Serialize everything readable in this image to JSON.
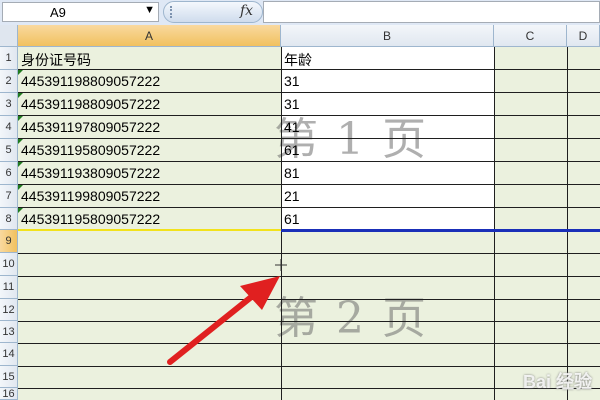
{
  "formula_bar": {
    "name_box": "A9",
    "fx_label": "fx",
    "formula": ""
  },
  "columns": [
    {
      "label": "A",
      "selected": true
    },
    {
      "label": "B",
      "selected": false
    },
    {
      "label": "C",
      "selected": false
    },
    {
      "label": "D",
      "selected": false
    }
  ],
  "rows": [
    "1",
    "2",
    "3",
    "4",
    "5",
    "6",
    "7",
    "8",
    "9",
    "10",
    "11",
    "12",
    "13",
    "14",
    "15",
    "16"
  ],
  "header_row": {
    "col_a": "身份证号码",
    "col_b": "年龄"
  },
  "data_rows": [
    {
      "id": "445391198809057222",
      "age": "31"
    },
    {
      "id": "445391198809057222",
      "age": "31"
    },
    {
      "id": "445391197809057222",
      "age": "41"
    },
    {
      "id": "445391195809057222",
      "age": "61"
    },
    {
      "id": "445391193809057222",
      "age": "81"
    },
    {
      "id": "445391199809057222",
      "age": "21"
    },
    {
      "id": "445391195809057222",
      "age": "61"
    }
  ],
  "page_labels": {
    "page1": "第 1 页",
    "page2": "第 2 页"
  },
  "watermark": "Bai 经验",
  "colors": {
    "cell_background": "#ebf1de",
    "page_break": "#1a2fb8",
    "arrow": "#e02020",
    "selected_cell_border": "#f2e21b"
  }
}
